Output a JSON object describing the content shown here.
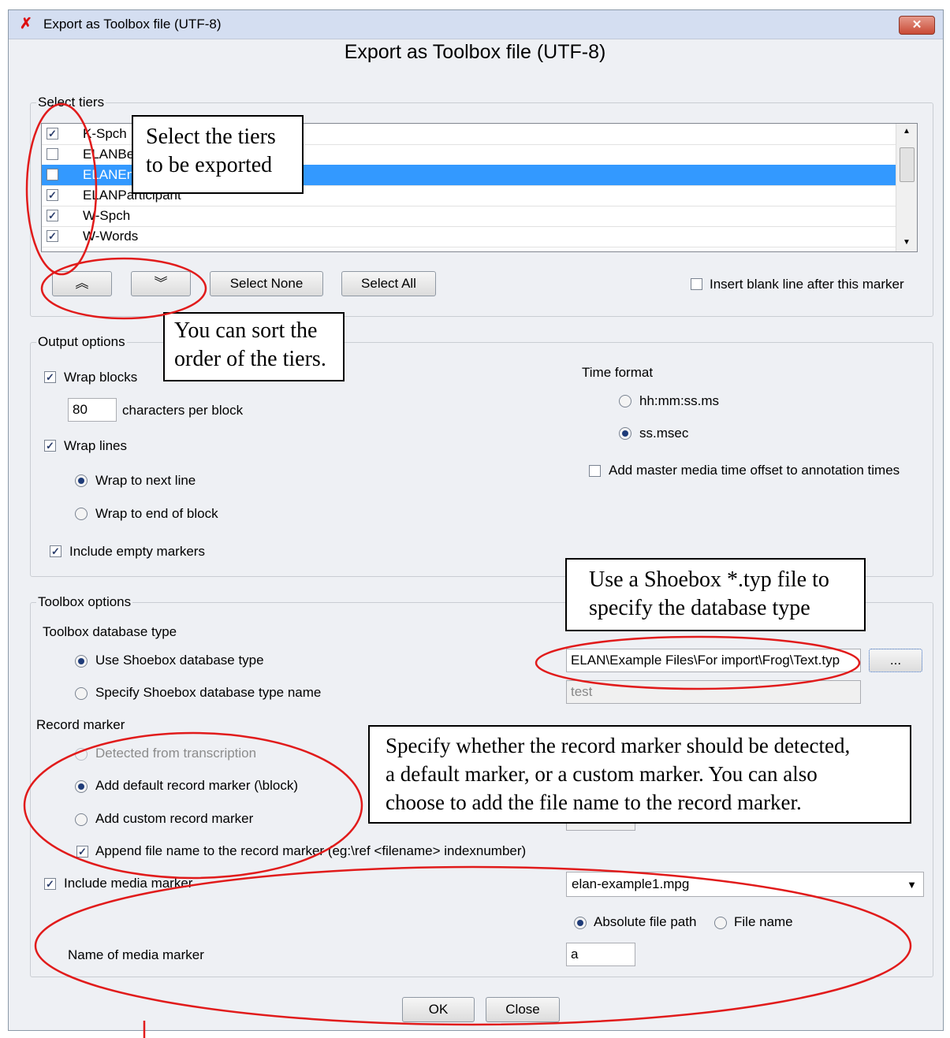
{
  "window": {
    "title": "Export as Toolbox file (UTF-8)",
    "close_glyph": "✕",
    "dialog_title": "Export as Toolbox file (UTF-8)"
  },
  "select_tiers": {
    "group_label": "Select tiers",
    "tiers": [
      {
        "name": "K-Spch",
        "checked": true
      },
      {
        "name": "ELANBe",
        "checked": false
      },
      {
        "name": "ELANEn",
        "checked": false,
        "selected": true
      },
      {
        "name": "ELANParticipant",
        "checked": true
      },
      {
        "name": "W-Spch",
        "checked": true
      },
      {
        "name": "W-Words",
        "checked": true
      }
    ],
    "move_up_glyph": "︽",
    "move_down_glyph": "︾",
    "select_none": "Select None",
    "select_all": "Select All",
    "insert_blank_line": "Insert blank line after this marker"
  },
  "output_options": {
    "group_label": "Output options",
    "wrap_blocks": "Wrap blocks",
    "chars_value": "80",
    "chars_label": "characters per block",
    "wrap_lines": "Wrap lines",
    "wrap_next_line": "Wrap to next line",
    "wrap_end_block": "Wrap to end of block",
    "include_empty": "Include empty markers",
    "time_format_label": "Time format",
    "time_hms": "hh:mm:ss.ms",
    "time_ss": "ss.msec",
    "add_offset": "Add master media time offset to annotation times"
  },
  "toolbox_options": {
    "group_label": "Toolbox options",
    "db_type_label": "Toolbox database type",
    "use_shoebox": "Use Shoebox database type",
    "typ_path": "ELAN\\Example Files\\For import\\Frog\\Text.typ",
    "browse": "...",
    "specify_name": "Specify Shoebox database type name",
    "name_value": "test",
    "record_marker_label": "Record marker",
    "detected": "Detected from transcription",
    "add_default": "Add default record marker (\\block)",
    "add_custom": "Add custom record marker",
    "append_file": "Append file name to the record marker (eg:\\ref <filename> indexnumber)",
    "include_media": "Include media marker",
    "media_file": "elan-example1.mpg",
    "absolute_path": "Absolute file path",
    "file_name": "File name",
    "media_marker_label": "Name of media marker",
    "media_marker_value": "a"
  },
  "buttons": {
    "ok": "OK",
    "close": "Close"
  },
  "callouts": {
    "tiers": [
      "Select the tiers",
      "to be exported"
    ],
    "sort": [
      "You can sort the",
      "order of the tiers."
    ],
    "typ": [
      "Use a Shoebox *.typ file to",
      "specify the database type"
    ],
    "record": [
      "Specify whether the record marker should be detected,",
      "a default marker, or a custom marker. You can also",
      "choose to add the file name to the record marker."
    ]
  },
  "colors": {
    "annotation": "#e11b1b",
    "selection": "#3399ff",
    "titlebar": "#d4def1"
  },
  "icons": {
    "app": "elan-app-icon",
    "check": "✓"
  }
}
